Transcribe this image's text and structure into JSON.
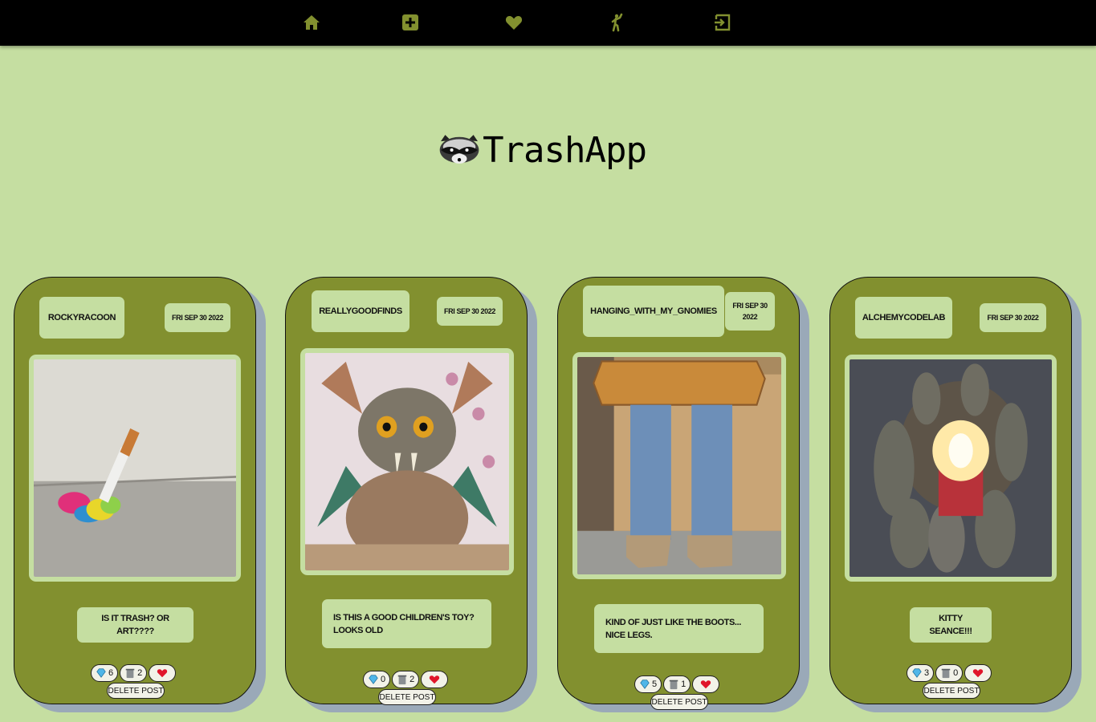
{
  "nav": {
    "items": [
      {
        "name": "home",
        "icon": "home-icon"
      },
      {
        "name": "add-post",
        "icon": "plus-square-icon"
      },
      {
        "name": "favorites",
        "icon": "heart-icon"
      },
      {
        "name": "profile",
        "icon": "person-waving-icon"
      },
      {
        "name": "logout",
        "icon": "logout-icon"
      }
    ],
    "icon_color": "#82902f"
  },
  "brand": {
    "name": "TrashApp",
    "logo_icon": "raccoon-icon"
  },
  "colors": {
    "page_bg": "#c5dea1",
    "card_bg": "#82902f",
    "pill_bg": "#c5dea1",
    "nav_bg": "#000000",
    "heart": "#e0162b"
  },
  "posts": [
    {
      "username": "ROCKYRACOON",
      "date": "FRI SEP 30 2022",
      "caption": "IS IT TRASH? OR ART????",
      "gems": "6",
      "trash": "2",
      "delete_label": "DELETE POST",
      "image": "cigarette-in-gummy-resin-photo"
    },
    {
      "username": "REALLYGOODFINDS",
      "date": "FRI SEP 30 2022",
      "caption": "IS THIS A GOOD CHILDREN'S TOY? LOOKS OLD",
      "gems": "0",
      "trash": "2",
      "delete_label": "DELETE POST",
      "image": "taxidermy-creature-photo"
    },
    {
      "username": "HANGING_WITH_MY_GNOMIES",
      "date": "FRI SEP 30 2022",
      "caption": "KIND OF JUST LIKE THE BOOTS... NICE LEGS.",
      "gems": "5",
      "trash": "1",
      "delete_label": "DELETE POST",
      "image": "jeans-leg-table-photo"
    },
    {
      "username": "ALCHEMYCODELAB",
      "date": "FRI SEP 30 2022",
      "caption": "KITTY SEANCE!!!",
      "gems": "3",
      "trash": "0",
      "delete_label": "DELETE POST",
      "image": "cats-around-candle-photo"
    }
  ]
}
